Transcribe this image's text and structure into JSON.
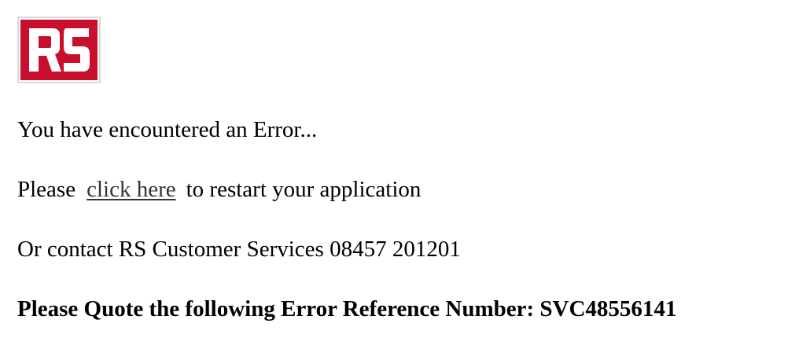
{
  "logo": {
    "text": "RS",
    "color": "#c8102e"
  },
  "message": {
    "error_heading": "You have encountered an Error...",
    "restart_prefix": "Please",
    "restart_link": "click here",
    "restart_suffix": "to restart your application",
    "contact": "Or contact RS Customer Services 08457 201201",
    "reference": "Please Quote the following Error Reference Number: SVC48556141"
  },
  "colors": {
    "link": "#333333",
    "text": "#000000"
  }
}
